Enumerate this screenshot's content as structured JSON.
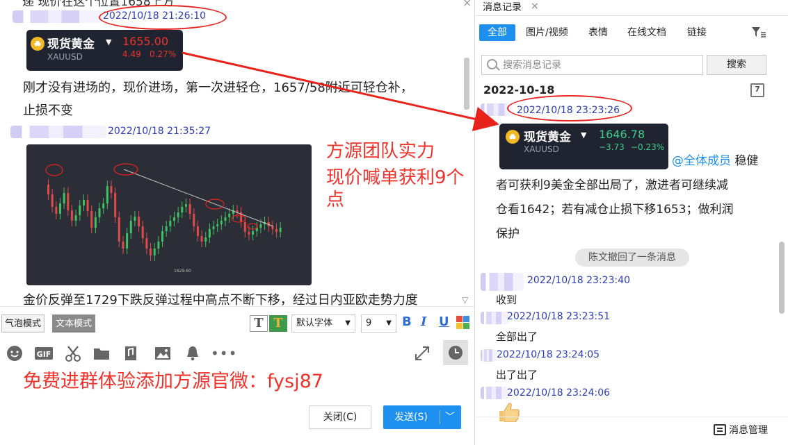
{
  "chat": {
    "close_glyph": "×",
    "msg1": {
      "time": "2022/10/18 21:26:10",
      "gold": {
        "name": "现货黄金",
        "caret": "▼",
        "symbol": "XAUUSD",
        "price": "1655.00",
        "change": "4.49",
        "change_pct": "0.27%",
        "color": "#f0322a"
      }
    },
    "msg1_text": [
      "刚才没有进场的，现价进场，第一次进轻仓，1657/58附近可轻仓补，",
      "止损不变"
    ],
    "msg2_time": "2022/10/18 21:35:27",
    "chart_price_label": "1629.60",
    "msg3_text": "金价反弹至1729下跌反弹过程中高点不断下移，经过日内亚欧走势力度",
    "annotation": [
      "方源团队实力",
      "现价喊单获利9个点"
    ],
    "promo": "免费进群体验添加方源官微：fysj87"
  },
  "input": {
    "mode_bubble": "气泡模式",
    "mode_text": "文本模式",
    "font_name": "默认字体",
    "font_size": "9",
    "bold": "B",
    "italic": "I",
    "underline": "U",
    "close_label": "关闭(C)",
    "send_label": "发送(S)"
  },
  "history": {
    "tab_label": "消息记录",
    "tab_close": "×",
    "filters": [
      "全部",
      "图片/视频",
      "表情",
      "在线文档",
      "链接"
    ],
    "search_placeholder": "搜索消息记录",
    "search_button": "搜索",
    "date": "2022-10-18",
    "calendar_day": "7",
    "msg1_time": "2022/10/18 23:23:26",
    "gold": {
      "name": "现货黄金",
      "caret": "▼",
      "symbol": "XAUUSD",
      "price": "1646.78",
      "change": "−3.73",
      "change_pct": "−0.23%",
      "color": "#3ccf8a"
    },
    "mention": "@全体成员",
    "text_line1": "稳健",
    "text_lines": [
      "者可获利9美金全部出局了，激进者可继续减",
      "仓看1642；若有减仓止损下移1653；做利润",
      "保护"
    ],
    "recall_notice": "陈文撤回了一条消息",
    "entries": [
      {
        "time": "2022/10/18 23:23:40",
        "text": "收到"
      },
      {
        "time": "2022/10/18 23:23:51",
        "text": "全部出了"
      },
      {
        "time": "2022/10/18 23:24:05",
        "text": "出了出了"
      },
      {
        "time": "2022/10/18 23:24:06",
        "text": ""
      }
    ],
    "manager_label": "消息管理"
  }
}
